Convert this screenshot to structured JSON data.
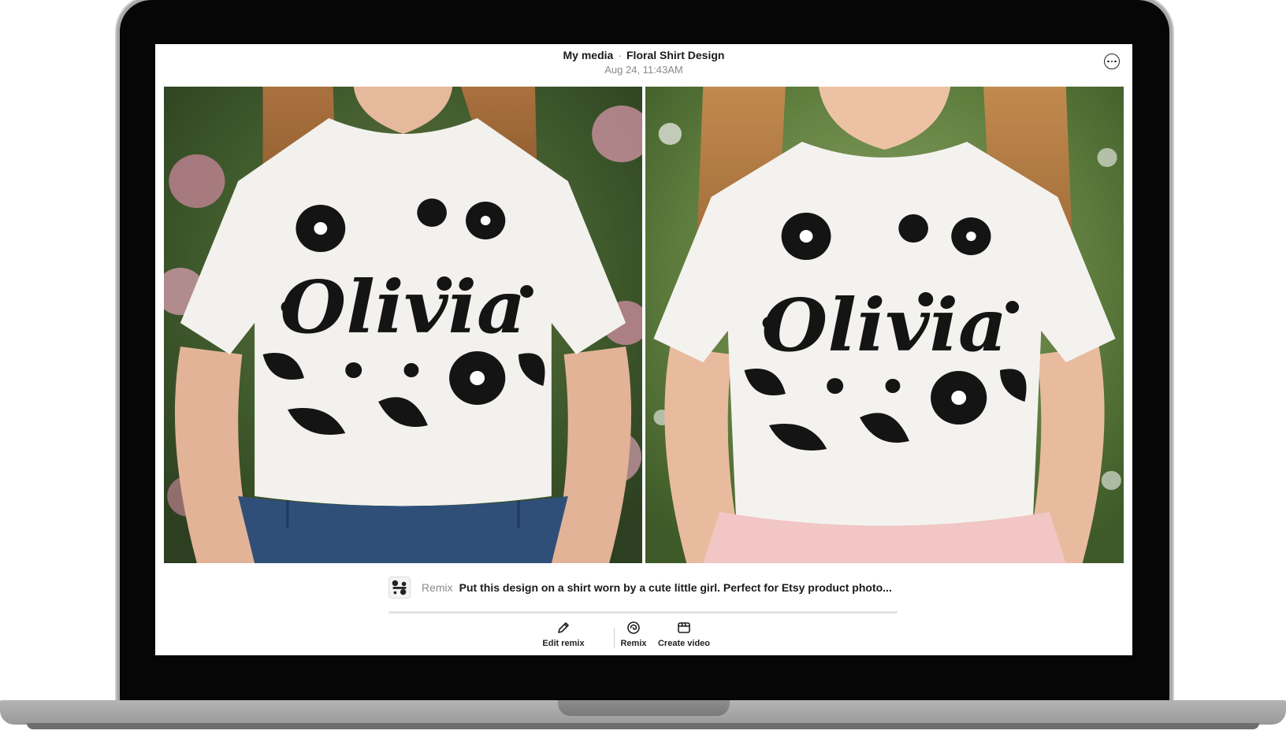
{
  "header": {
    "breadcrumb_root": "My media",
    "breadcrumb_separator": "·",
    "breadcrumb_current": "Floral Shirt Design",
    "timestamp": "Aug 24, 11:43AM",
    "more_icon": "more-horizontal-circle-icon"
  },
  "images": [
    {
      "design_text": "Olivia",
      "bottom": "denim jeans",
      "background": "pink flowers"
    },
    {
      "design_text": "Olivia",
      "bottom": "pink tulle skirt",
      "background": "green meadow"
    }
  ],
  "prompt": {
    "label": "Remix",
    "text": "Put this design on a shirt worn by a cute little girl. Perfect for Etsy product photo...",
    "thumb_icon": "design-thumbnail"
  },
  "actions": [
    {
      "label": "Edit remix",
      "icon": "pencil-icon"
    },
    {
      "label": "Remix",
      "icon": "remix-icon"
    },
    {
      "label": "Create video",
      "icon": "clapperboard-icon"
    }
  ],
  "colors": {
    "text_primary": "#1a1a1a",
    "text_muted": "#8a8a8a",
    "bezel": "#060606"
  }
}
